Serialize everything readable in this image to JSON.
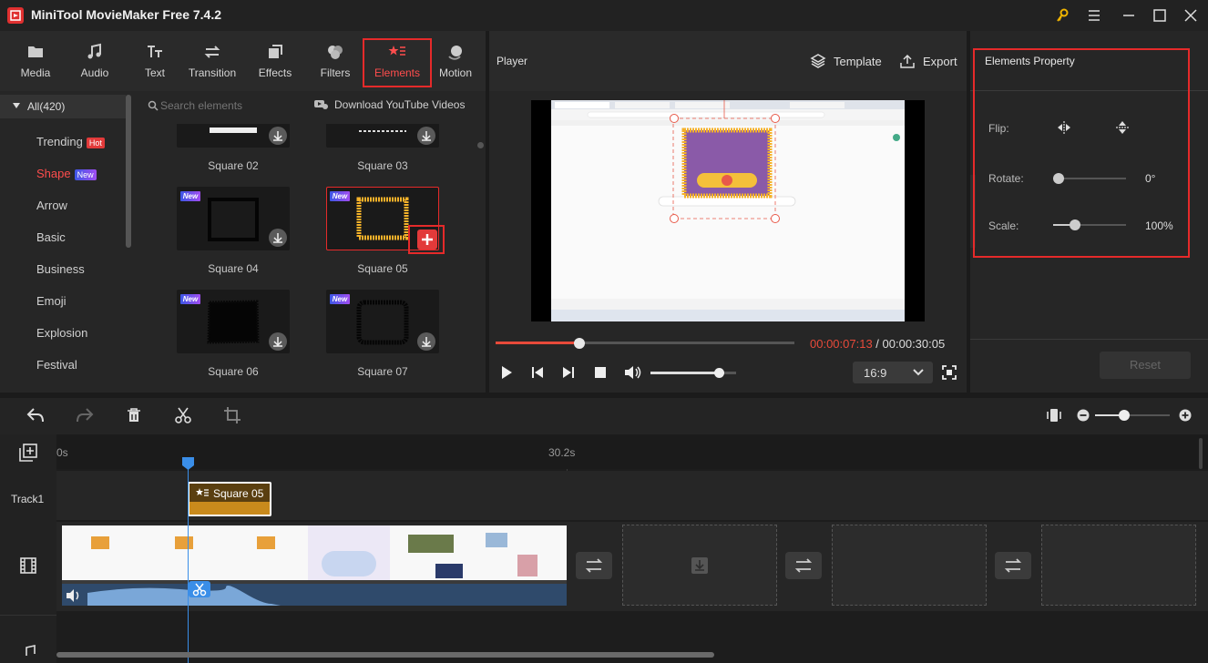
{
  "app": {
    "title": "MiniTool MovieMaker Free 7.4.2"
  },
  "toolbar": {
    "tabs": [
      {
        "label": "Media",
        "icon": "folder-icon"
      },
      {
        "label": "Audio",
        "icon": "music-note-icon"
      },
      {
        "label": "Text",
        "icon": "text-icon"
      },
      {
        "label": "Transition",
        "icon": "transition-icon"
      },
      {
        "label": "Effects",
        "icon": "effects-icon"
      },
      {
        "label": "Filters",
        "icon": "filters-icon"
      },
      {
        "label": "Elements",
        "icon": "elements-icon",
        "active": true
      },
      {
        "label": "Motion",
        "icon": "motion-icon"
      }
    ]
  },
  "categories": {
    "all": "All(420)",
    "items": [
      {
        "label": "Trending",
        "badge": "Hot"
      },
      {
        "label": "Shape",
        "badge": "New",
        "active": true
      },
      {
        "label": "Arrow"
      },
      {
        "label": "Basic"
      },
      {
        "label": "Business"
      },
      {
        "label": "Emoji"
      },
      {
        "label": "Explosion"
      },
      {
        "label": "Festival"
      }
    ]
  },
  "elements": {
    "search_placeholder": "Search elements",
    "download_link": "Download YouTube Videos",
    "new_badge": "New",
    "items": [
      {
        "label": "Square 02"
      },
      {
        "label": "Square 03"
      },
      {
        "label": "Square 04"
      },
      {
        "label": "Square 05"
      },
      {
        "label": "Square 06"
      },
      {
        "label": "Square 07"
      }
    ]
  },
  "player": {
    "title": "Player",
    "template_label": "Template",
    "export_label": "Export",
    "current_time": "00:00:07:13",
    "separator": " / ",
    "total_time": "00:00:30:05",
    "aspect": "16:9",
    "progress": 0.28,
    "volume": 0.8
  },
  "properties": {
    "title": "Elements Property",
    "flip_label": "Flip:",
    "rotate_label": "Rotate:",
    "rotate_value": "0°",
    "scale_label": "Scale:",
    "scale_value": "100%",
    "reset_label": "Reset"
  },
  "timeline": {
    "ruler_start": "0s",
    "ruler_mid": "30.2s",
    "track1_label": "Track1",
    "element_clip": "Square 05"
  },
  "colors": {
    "accent_red": "#e52a2a",
    "time_red": "#e84a3a",
    "clip_gold": "#c98a1c"
  }
}
